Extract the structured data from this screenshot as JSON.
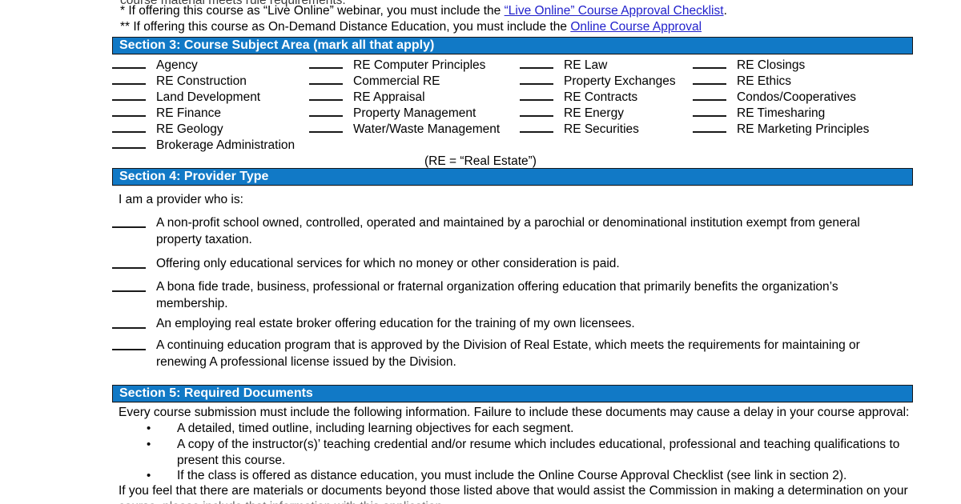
{
  "document": {
    "clipped_top_line": "course material meets rule requirements.",
    "notes": [
      {
        "prefix": "* If offering this course as “Live Online” webinar, you must include the ",
        "link": "“Live Online” Course Approval Checklist",
        "suffix": "."
      },
      {
        "prefix": "** If offering this course as On-Demand Distance Education, you must include the ",
        "link": "Online Course Approval",
        "suffix": ""
      }
    ]
  },
  "colors": {
    "section_bar_background": "#1179c6",
    "section_bar_text": "#ffffff",
    "section_bar_border": "#17171a",
    "hyperlink": "#2222cc",
    "body_text": "#000000"
  },
  "section3": {
    "heading": "Section 3: Course Subject Area (mark all that apply)",
    "rows": [
      [
        "Agency",
        "RE Computer Principles",
        "RE Law",
        "RE Closings"
      ],
      [
        "RE Construction",
        "Commercial RE",
        "Property Exchanges",
        "RE Ethics"
      ],
      [
        "Land Development",
        "RE Appraisal",
        "RE Contracts",
        "Condos/Cooperatives"
      ],
      [
        "RE Finance",
        "Property Management",
        "RE Energy",
        "RE Timesharing"
      ],
      [
        "RE Geology",
        "Water/Waste Management",
        "RE Securities",
        "RE Marketing Principles"
      ],
      [
        "Brokerage Administration",
        "",
        "",
        ""
      ]
    ],
    "footnote": "(RE = “Real Estate”)"
  },
  "section4": {
    "heading": "Section 4: Provider Type",
    "intro": "I am a provider who is:",
    "options": [
      "A non-profit school owned, controlled, operated and maintained by a parochial or denominational institution exempt from general property taxation.",
      "Offering only educational services for which no money or other consideration is paid.",
      "A bona fide trade, business, professional or fraternal organization offering education that primarily benefits the organization’s membership.",
      "An employing real estate broker offering education for the training of my own licensees.",
      "A continuing education program that is approved by the Division of Real Estate, which meets the requirements for maintaining or renewing A professional license issued by the Division."
    ]
  },
  "section5": {
    "heading": "Section 5: Required Documents",
    "intro": "Every course submission must include the following information. Failure to include these documents may cause a delay in your course approval:",
    "bullet_glyph": "•",
    "bullets": [
      "A detailed, timed outline, including learning objectives for each segment.",
      "A copy of the instructor(s)’ teaching credential and/or resume which includes educational, professional and teaching qualifications to present this course.",
      "If the class is offered as distance education, you must include the Online Course Approval Checklist (see link in section 2)."
    ],
    "closing_paragraph": "If you feel that there are materials or documents beyond those listed above that would assist the Commission in making a determination on your",
    "closing_clipped": "course, please include that information with this application."
  }
}
